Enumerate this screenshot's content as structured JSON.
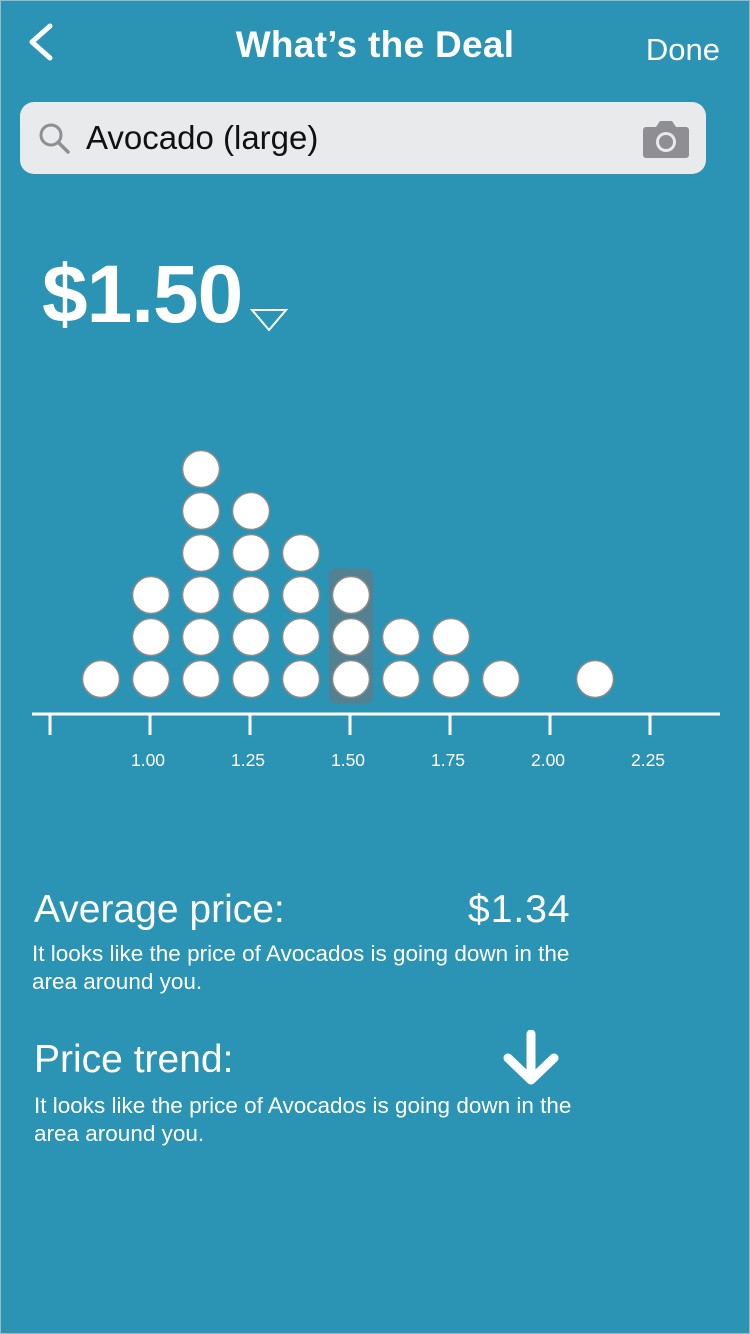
{
  "nav": {
    "title": "What’s the Deal",
    "done_label": "Done",
    "back_icon": "chevron-left-icon"
  },
  "search": {
    "value": "Avocado (large)",
    "placeholder": "Search",
    "search_icon": "search-icon",
    "camera_icon": "camera-icon"
  },
  "price": {
    "current": "$1.50",
    "dropdown_icon": "triangle-down-icon"
  },
  "chart_data": {
    "type": "scatter",
    "title": "",
    "xlabel": "",
    "ylabel": "",
    "x_ticks": [
      0.875,
      1.0,
      1.125,
      1.25,
      1.375,
      1.5,
      1.625,
      1.75,
      1.875,
      2.0,
      2.125,
      2.25
    ],
    "x_tick_labels": [
      "1.00",
      "1.25",
      "1.50",
      "1.75",
      "2.00",
      "2.25"
    ],
    "xlim": [
      0.75,
      2.43
    ],
    "series": [
      {
        "bins": [
          0.875,
          1.0,
          1.125,
          1.25,
          1.375,
          1.5,
          1.625,
          1.75,
          1.875,
          2.11
        ],
        "counts": [
          1,
          3,
          6,
          5,
          4,
          3,
          2,
          2,
          1,
          1
        ]
      }
    ],
    "highlighted_bin": 1.5,
    "grid": false,
    "legend": "none"
  },
  "stats": {
    "average_label": "Average price:",
    "average_value": "$1.34",
    "average_desc": "It looks like the price of Avocados is going down in the area around you.",
    "trend_label": "Price trend:",
    "trend_icon": "arrow-down-icon",
    "trend_desc": "It looks like the price of Avocados is going down in the area around you."
  },
  "colors": {
    "background": "#2b93b3",
    "dot_fill": "#ffffff",
    "dot_stroke": "#8a8a8a",
    "highlight": "#5b7e8c",
    "search_bg": "#e9eaec"
  }
}
